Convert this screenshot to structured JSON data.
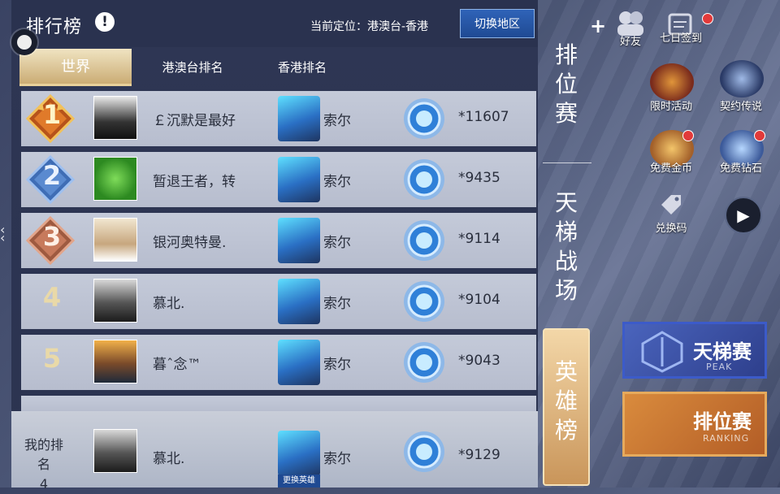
{
  "header": {
    "title": "排行榜",
    "info_icon": "!",
    "location_text": "当前定位：港澳台-香港",
    "switch_region_label": "切换地区"
  },
  "tabs": [
    {
      "label": "世界",
      "active": true
    },
    {
      "label": "港澳台排名",
      "active": false
    },
    {
      "label": "香港排名",
      "active": false
    }
  ],
  "rows": [
    {
      "rank": "1",
      "name": "￡沉默是最好",
      "hero": "索尔",
      "score": "*11607"
    },
    {
      "rank": "2",
      "name": "暂退王者，转",
      "hero": "索尔",
      "score": "*9435"
    },
    {
      "rank": "3",
      "name": "银河奥特曼.",
      "hero": "索尔",
      "score": "*9114"
    },
    {
      "rank": "4",
      "name": "慕北.",
      "hero": "索尔",
      "score": "*9104"
    },
    {
      "rank": "5",
      "name": "暮ˆ念™",
      "hero": "索尔",
      "score": "*9043"
    }
  ],
  "my_rank": {
    "label": "我的排名",
    "rank": "4",
    "name": "慕北.",
    "hero": "索尔",
    "score": "*9129",
    "change_hero_label": "更换英雄"
  },
  "side_tabs": [
    {
      "label": "排\n位\n赛",
      "active": false
    },
    {
      "label": "天\n梯\n战\n场",
      "active": false
    },
    {
      "label": "英\n雄\n榜",
      "active": true
    }
  ],
  "right_menu": {
    "friends_label": "好友",
    "seven_day_label": "七日签到",
    "limited_event_label": "限时活动",
    "contract_label": "契约传说",
    "free_gold_label": "免费金币",
    "free_diamond_label": "免费钻石",
    "redeem_label": "兑换码"
  },
  "mode_buttons": {
    "ladder_title": "天梯赛",
    "ladder_sub": "PEAK",
    "ranking_title": "排位赛",
    "ranking_sub": "RANKING"
  },
  "colors": {
    "gold": "#e9d9a8",
    "accent_blue": "#2f63b8",
    "active_tab": "#c8a86f",
    "row_bg": "#c4cad9"
  }
}
